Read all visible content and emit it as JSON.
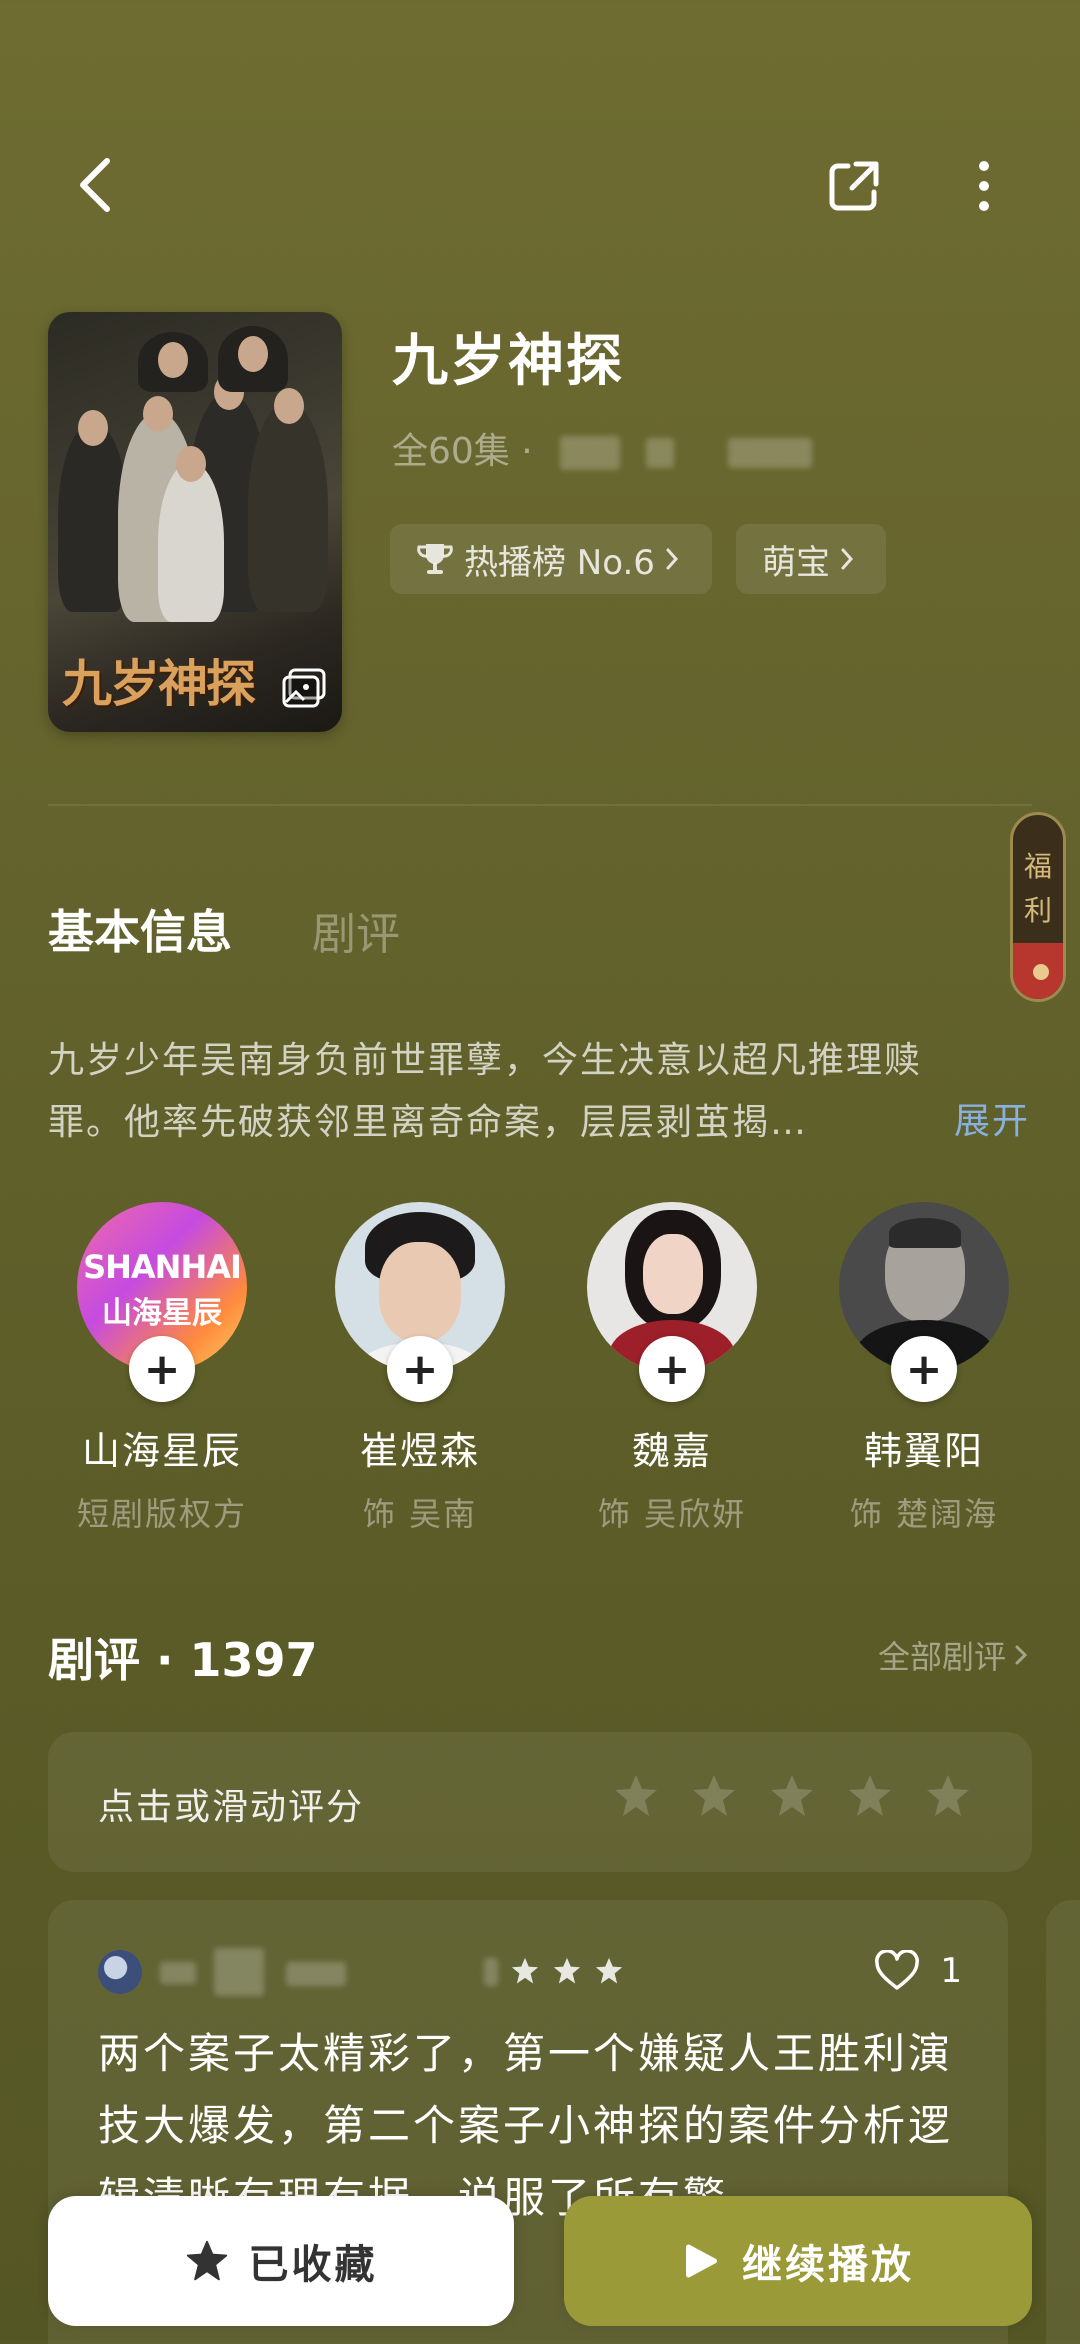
{
  "header": {
    "back_icon": "chevron-left-icon",
    "share_icon": "share-icon",
    "more_icon": "more-vertical-icon"
  },
  "drama": {
    "poster_title": "九岁神探",
    "title": "九岁神探",
    "episodes": "全60集 · ",
    "chips": [
      {
        "label": "热播榜 No.6",
        "icon": "trophy-icon"
      },
      {
        "label": "萌宝",
        "icon": ""
      }
    ]
  },
  "fuli": {
    "label_1": "福",
    "label_2": "利"
  },
  "tabs": {
    "info": "基本信息",
    "reviews": "剧评"
  },
  "description": {
    "line1": "九岁少年吴南身负前世罪孽，今生决意以超凡推理赎",
    "line2": "罪。他率先破获邻里离奇命案，层层剥茧揭…",
    "expand": "展开"
  },
  "cast": [
    {
      "name": "山海星辰",
      "role": "短剧版权方",
      "logo_line1": "SHANHAI",
      "logo_line2": "山海星辰"
    },
    {
      "name": "崔煜森",
      "role": "饰 吴南"
    },
    {
      "name": "魏嘉",
      "role": "饰 吴欣妍"
    },
    {
      "name": "韩翼阳",
      "role": "饰 楚阔海"
    }
  ],
  "reviews": {
    "title": "剧评 · 1397",
    "all_link": "全部剧评",
    "rate_prompt": "点击或滑动评分",
    "rating_stars_total": 5,
    "item": {
      "likes": "1",
      "stars": 3,
      "text": "两个案子太精彩了，第一个嫌疑人王胜利演技大爆发，第二个案子小神探的案件分析逻辑清晰有理有据，说服了所有警"
    }
  },
  "bottom": {
    "favorite_label": "已收藏",
    "play_label": "继续播放"
  },
  "colors": {
    "background": "#64632d",
    "play_button": "#9a9a38",
    "expand_link": "#8ab0e0"
  }
}
